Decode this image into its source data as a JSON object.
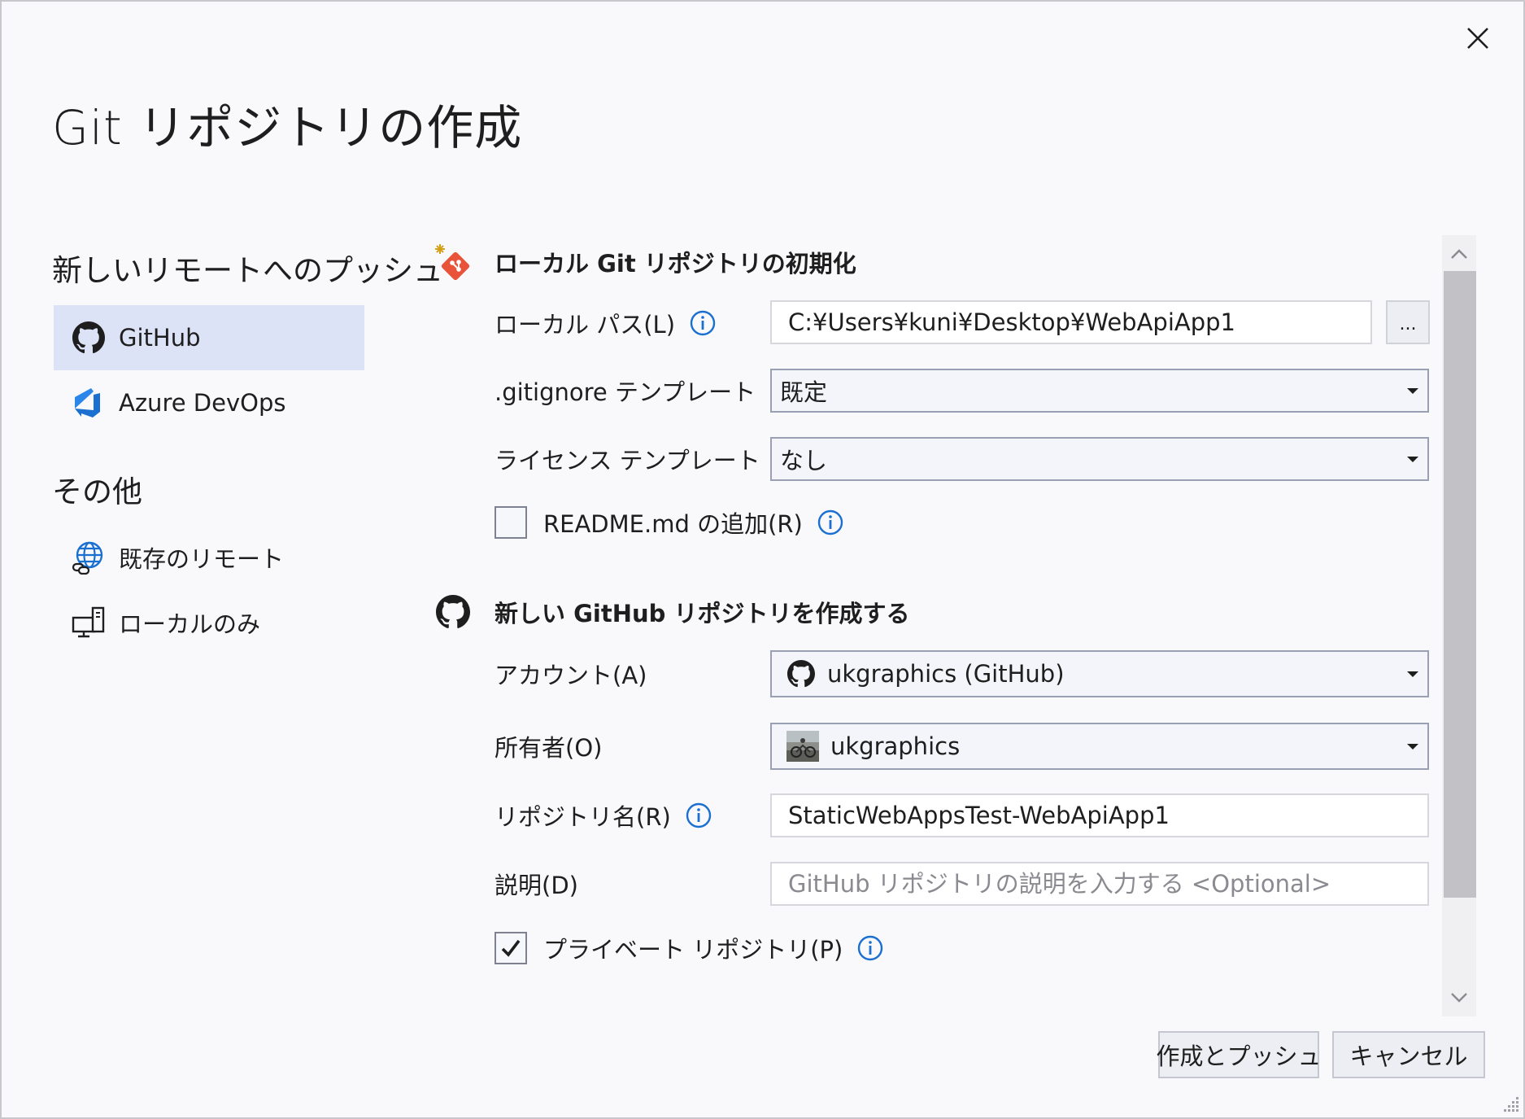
{
  "dialog": {
    "title": "Git リポジトリの作成",
    "close_icon": "close-icon"
  },
  "nav": {
    "push_heading": "新しいリモートへのプッシュ",
    "push_items": [
      {
        "label": "GitHub",
        "icon": "github-icon",
        "selected": true
      },
      {
        "label": "Azure DevOps",
        "icon": "azure-devops-icon",
        "selected": false
      }
    ],
    "other_heading": "その他",
    "other_items": [
      {
        "label": "既存のリモート",
        "icon": "globe-link-icon"
      },
      {
        "label": "ローカルのみ",
        "icon": "local-computer-icon"
      }
    ]
  },
  "local_section": {
    "title": "ローカル Git リポジトリの初期化",
    "local_path_label": "ローカル パス(L)",
    "local_path_value": "C:¥Users¥kuni¥Desktop¥WebApiApp1",
    "browse_label": "...",
    "gitignore_label": ".gitignore テンプレート",
    "gitignore_value": "既定",
    "license_label": "ライセンス テンプレート",
    "license_value": "なし",
    "readme_label": "README.md の追加(R)",
    "readme_checked": false
  },
  "github_section": {
    "title": "新しい GitHub リポジトリを作成する",
    "account_label": "アカウント(A)",
    "account_value": "ukgraphics (GitHub)",
    "owner_label": "所有者(O)",
    "owner_value": "ukgraphics",
    "repo_name_label": "リポジトリ名(R)",
    "repo_name_value": "StaticWebAppsTest-WebApiApp1",
    "description_label": "説明(D)",
    "description_placeholder": "GitHub リポジトリの説明を入力する <Optional>",
    "private_label": "プライベート リポジトリ(P)",
    "private_checked": true
  },
  "footer": {
    "create_push_label": "作成とプッシュ",
    "cancel_label": "キャンセル"
  },
  "colors": {
    "accent": "#1a6fd1",
    "selected_nav": "#dde3f7",
    "git_orange": "#e8533a"
  }
}
